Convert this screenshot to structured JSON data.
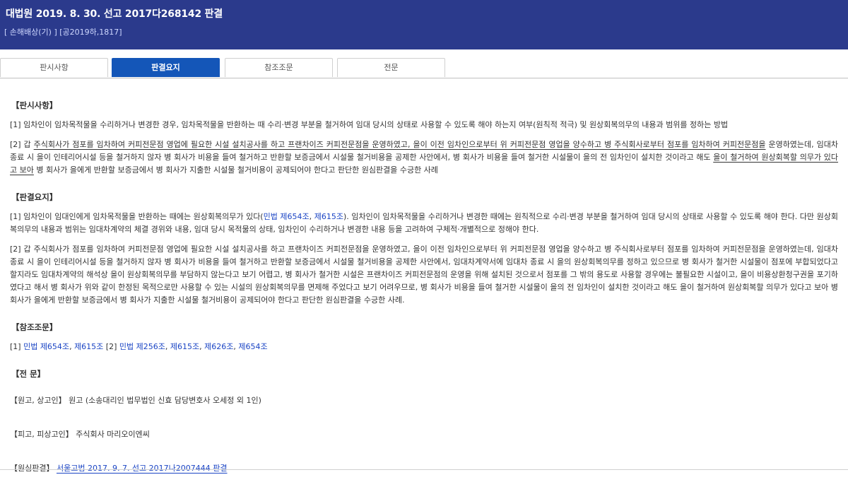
{
  "header": {
    "title": "대법원 2019. 8. 30. 선고 2017다268142 판결",
    "subtitle": "[ 손해배상(기) ] [공2019하,1817]"
  },
  "tabs": [
    "판시사항",
    "판결요지",
    "참조조문",
    "전문"
  ],
  "active_tab": "판결요지",
  "sections": {
    "panshi_title": "【판시사항】",
    "panshi_1": "[1] 임차인이 임차목적물을 수리하거나 변경한 경우, 임차목적물을 반환하는 때 수리·변경 부분을 철거하여 임대 당시의 상태로 사용할 수 있도록 해야 하는지 여부(원칙적 적극) 및 원상회복의무의 내용과 범위를 정하는 방법",
    "panshi_2a": "[2] 갑 ",
    "panshi_2b": "주식회사가 점포를 임차하여 커피전문점 영업에 필요한 시설 설치공사를 하고 프랜차이즈 커피전문점을 운영하였고, 을이 이전 임차인으로부터 위 커피전문점 영업을 양수하고 병 주식회사로부터 점포를 임차하여 커피전문점을",
    "panshi_2c": " 운영하였는데, 임대차 종료 시 을이 인테리어시설 등을 철거하지 않자 병 회사가 비용을 들여 철거하고 반환할 보증금에서 시설물 철거비용을 공제한 사안에서, 병 회사가 비용을 들여 철거한 시설물이 을의 전 임차인이 설치한 것이라고 해도 ",
    "panshi_2d": "을이 철거하여 원상회복할 의무가 있다고 보아",
    "panshi_2e": " 병 회사가 을에게 반환할 보증금에서 병 회사가 지출한 시설물 철거비용이 공제되어야 한다고 판단한 원심판결을 수긍한 사례",
    "yoji_title": "【판결요지】",
    "yoji_1a": "[1] 임차인이 임대인에게 임차목적물을 반환하는 때에는 원상회복의무가 있다(",
    "yoji_1_link1": "민법 제654조",
    "yoji_1_sep": ", ",
    "yoji_1_link2": "제615조",
    "yoji_1b": "). 임차인이 임차목적물을 수리하거나 변경한 때에는 원칙적으로 수리·변경 부분을 철거하여 임대 당시의 상태로 사용할 수 있도록 해야 한다. 다만 원상회복의무의 내용과 범위는 임대차계약의 체결 경위와 내용, 임대 당시 목적물의 상태, 임차인이 수리하거나 변경한 내용 등을 고려하여 구체적·개별적으로 정해야 한다.",
    "yoji_2": "[2] 갑 주식회사가 점포를 임차하여 커피전문점 영업에 필요한 시설 설치공사를 하고 프랜차이즈 커피전문점을 운영하였고, 을이 이전 임차인으로부터 위 커피전문점 영업을 양수하고 병 주식회사로부터 점포를 임차하여 커피전문점을 운영하였는데, 임대차 종료 시 을이 인테리어시설 등을 철거하지 않자 병 회사가 비용을 들여 철거하고 반환할 보증금에서 시설물 철거비용을 공제한 사안에서, 임대차계약서에 임대차 종료 시 을의 원상회복의무를 정하고 있으므로 병 회사가 철거한 시설물이 점포에 부합되었다고 할지라도 임대차계약의 해석상 을이 원상회복의무를 부담하지 않는다고 보기 어렵고, 병 회사가 철거한 시설은 프랜차이즈 커피전문점의 운영을 위해 설치된 것으로서 점포를 그 밖의 용도로 사용할 경우에는 불필요한 시설이고, 을이 비용상환청구권을 포기하였다고 해서 병 회사가 위와 같이 한정된 목적으로만 사용할 수 있는 시설의 원상회복의무를 면제해 주었다고 보기 어려우므로, 병 회사가 비용을 들여 철거한 시설물이 을의 전 임차인이 설치한 것이라고 해도 을이 철거하여 원상회복할 의무가 있다고 보아 병 회사가 을에게 반환할 보증금에서 병 회사가 지출한 시설물 철거비용이 공제되어야 한다고 판단한 원심판결을 수긍한 사례.",
    "ref_title": "【참조조문】",
    "ref_p1": "[1] ",
    "ref_l1": "민법 제654조",
    "ref_c1": ", ",
    "ref_l2": "제615조",
    "ref_p2": " [2] ",
    "ref_l3": "민법 제256조",
    "ref_c2": ", ",
    "ref_l4": "제615조",
    "ref_c3": ", ",
    "ref_l5": "제626조",
    "ref_c4": ", ",
    "ref_l6": "제654조",
    "full_title": "【전 문】",
    "plaintiff": "【원고, 상고인】 원고 (소송대리인 법무법인 신효 담당변호사 오세정 외 1인)",
    "defendant": "【피고, 피상고인】 주식회사 마리오이엔씨",
    "lower_label": "【원심판결】 ",
    "lower_link": "서울고법 2017. 9. 7. 선고 2017나2007444 판결"
  }
}
